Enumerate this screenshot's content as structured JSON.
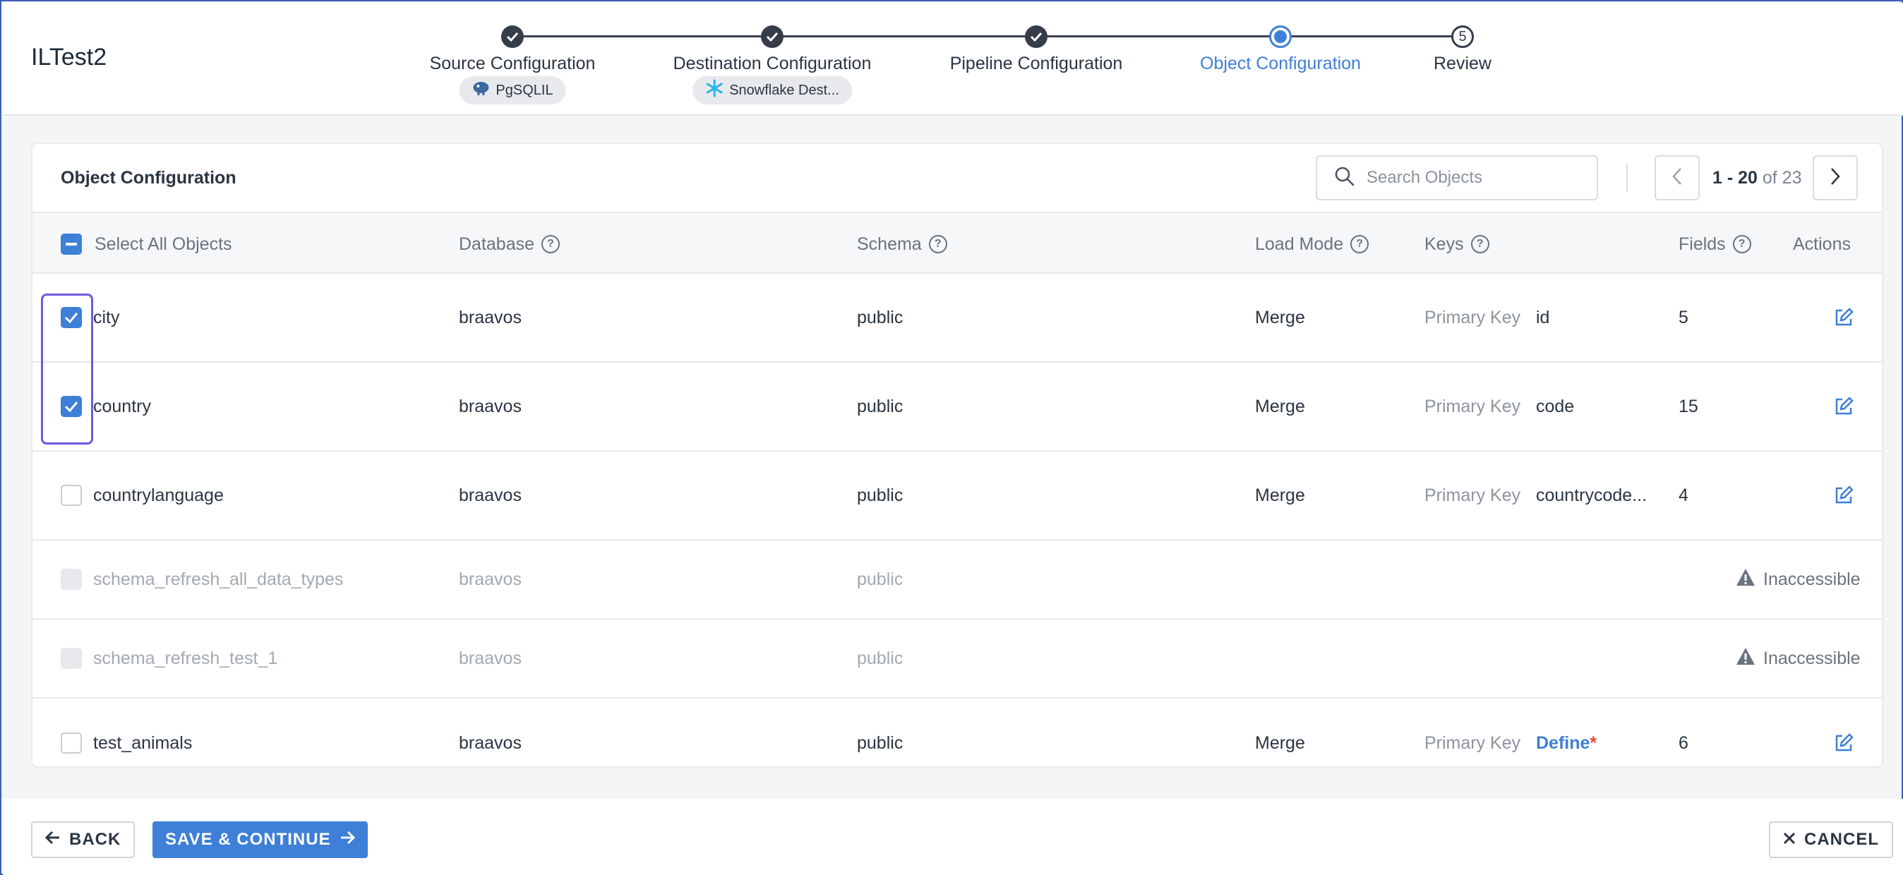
{
  "app": {
    "title": "ILTest2"
  },
  "stepper": {
    "steps": [
      {
        "label": "Source Configuration",
        "state": "done",
        "chip": "PgSQLIL",
        "chip_icon": "postgres-elephant-icon"
      },
      {
        "label": "Destination Configuration",
        "state": "done",
        "chip": "Snowflake Dest...",
        "chip_icon": "snowflake-icon"
      },
      {
        "label": "Pipeline Configuration",
        "state": "done"
      },
      {
        "label": "Object Configuration",
        "state": "active"
      },
      {
        "label": "Review",
        "state": "todo",
        "number": "5"
      }
    ]
  },
  "card": {
    "title": "Object Configuration",
    "search": {
      "placeholder": "Search Objects",
      "value": ""
    },
    "pager": {
      "range": "1 - 20",
      "of": "of 23"
    }
  },
  "table": {
    "headers": {
      "select_all": "Select All Objects",
      "database": "Database",
      "schema": "Schema",
      "load_mode": "Load Mode",
      "keys": "Keys",
      "fields": "Fields",
      "actions": "Actions"
    },
    "rows": [
      {
        "name": "city",
        "database": "braavos",
        "schema": "public",
        "load_mode": "Merge",
        "key_type": "Primary Key",
        "key": "id",
        "fields": "5",
        "checked": true
      },
      {
        "name": "country",
        "database": "braavos",
        "schema": "public",
        "load_mode": "Merge",
        "key_type": "Primary Key",
        "key": "code",
        "fields": "15",
        "checked": true
      },
      {
        "name": "countrylanguage",
        "database": "braavos",
        "schema": "public",
        "load_mode": "Merge",
        "key_type": "Primary Key",
        "key": "countrycode...",
        "fields": "4",
        "checked": false
      },
      {
        "name": "schema_refresh_all_data_types",
        "database": "braavos",
        "schema": "public",
        "status": "Inaccessible",
        "disabled": true
      },
      {
        "name": "schema_refresh_test_1",
        "database": "braavos",
        "schema": "public",
        "status": "Inaccessible",
        "disabled": true
      },
      {
        "name": "test_animals",
        "database": "braavos",
        "schema": "public",
        "load_mode": "Merge",
        "key_type": "Primary Key",
        "key_define": "Define",
        "key_required_mark": "*",
        "fields": "6",
        "checked": false
      }
    ]
  },
  "footer": {
    "back_label": "BACK",
    "save_label": "SAVE & CONTINUE",
    "cancel_label": "CANCEL"
  },
  "colors": {
    "accent": "#3e7fd8",
    "dark": "#353d4b",
    "highlight": "#6b5ce0",
    "required": "#e24b3b"
  }
}
